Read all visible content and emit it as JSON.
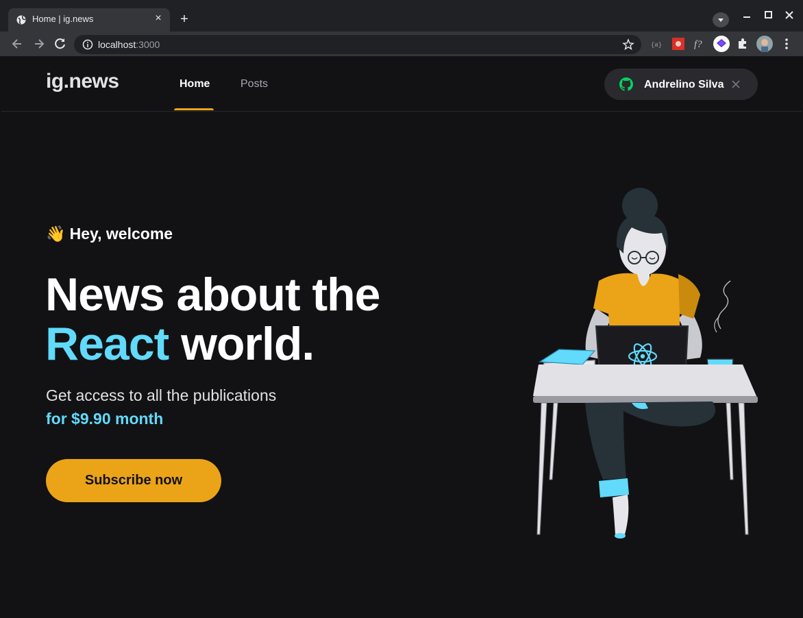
{
  "browser": {
    "tab_title": "Home | ig.news",
    "url_host": "localhost",
    "url_port": ":3000"
  },
  "header": {
    "logo": "ig.news",
    "nav": [
      {
        "label": "Home",
        "active": true
      },
      {
        "label": "Posts",
        "active": false
      }
    ],
    "user": {
      "name": "Andrelino Silva",
      "icon": "github-icon"
    }
  },
  "hero": {
    "welcome_emoji": "👋",
    "welcome": "Hey, welcome",
    "headline_line1": "News about the",
    "headline_accent": "React",
    "headline_rest": " world.",
    "sub_access": "Get access to all the publications",
    "sub_price": "for $9.90 month",
    "cta": "Subscribe now"
  },
  "colors": {
    "background": "#121214",
    "accent_yellow": "#eba417",
    "accent_cyan": "#61dafb",
    "github_green": "#04d361"
  }
}
